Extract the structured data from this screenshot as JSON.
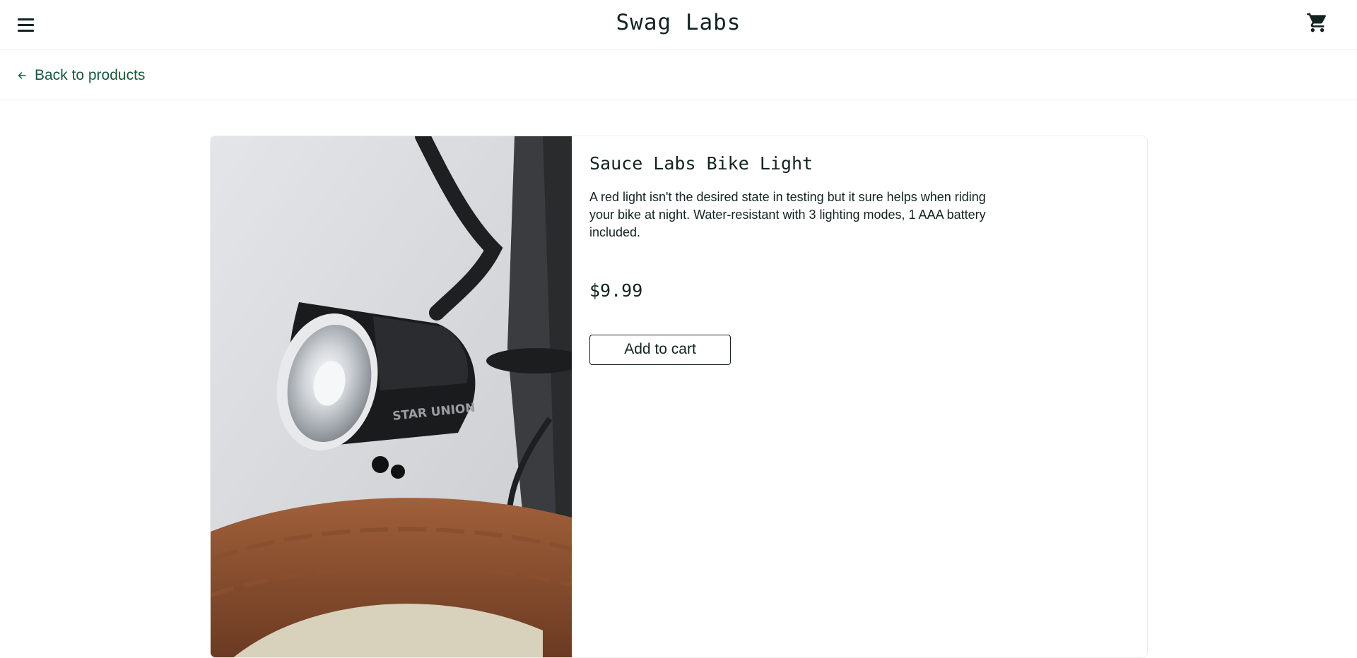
{
  "header": {
    "app_title": "Swag Labs",
    "menu_icon": "hamburger-menu-icon",
    "cart_icon": "shopping-cart-icon"
  },
  "secondary_header": {
    "back_label": "Back to products",
    "back_icon": "arrow-left-icon"
  },
  "product": {
    "name": "Sauce Labs Bike Light",
    "description": "A red light isn't the desired state in testing but it sure helps when riding your bike at night. Water-resistant with 3 lighting modes, 1 AAA battery included.",
    "price": "$9.99",
    "add_to_cart_label": "Add to cart",
    "image_brand_text": "STAR UNION"
  },
  "colors": {
    "text": "#132322",
    "link_green": "#18583a",
    "border": "#ededed",
    "background": "#ffffff"
  }
}
